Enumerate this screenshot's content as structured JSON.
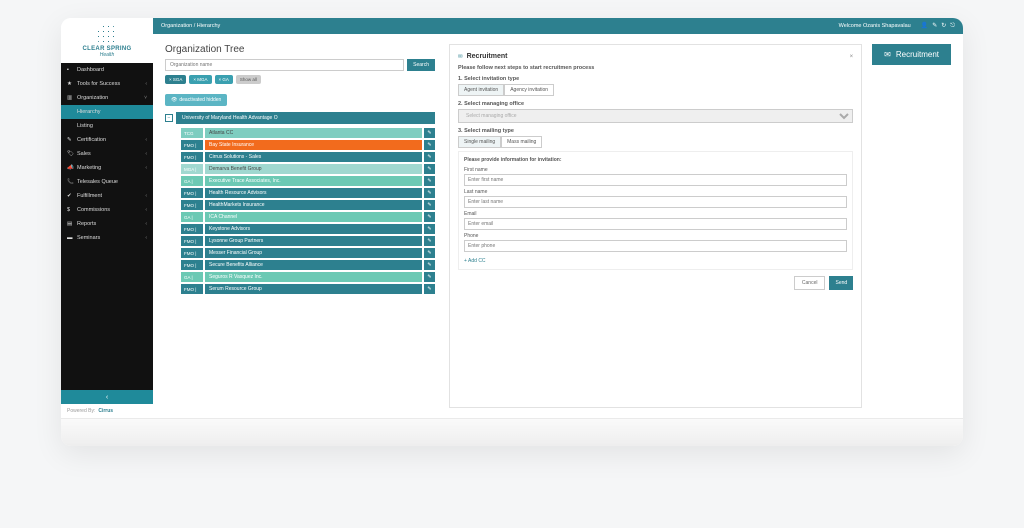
{
  "logo": {
    "line1": "CLEAR SPRING",
    "line2": "Health"
  },
  "nav": {
    "items": [
      {
        "icon": "▪",
        "label": "Dashboard",
        "chev": ""
      },
      {
        "icon": "★",
        "label": "Tools for Success",
        "chev": "‹"
      },
      {
        "icon": "▥",
        "label": "Organization",
        "chev": "˅"
      }
    ],
    "sub": [
      {
        "label": "Hierarchy",
        "active": true
      },
      {
        "label": "Listing",
        "active": false
      }
    ],
    "items2": [
      {
        "icon": "✎",
        "label": "Certification",
        "chev": "‹"
      },
      {
        "icon": "🏷",
        "label": "Sales",
        "chev": "‹"
      },
      {
        "icon": "📣",
        "label": "Marketing",
        "chev": "‹"
      },
      {
        "icon": "📞",
        "label": "Telesales Queue",
        "chev": ""
      },
      {
        "icon": "✔",
        "label": "Fulfillment",
        "chev": "‹"
      },
      {
        "icon": "$",
        "label": "Commissions",
        "chev": "‹"
      },
      {
        "icon": "▤",
        "label": "Reports",
        "chev": "‹"
      },
      {
        "icon": "▬",
        "label": "Seminars",
        "chev": "‹"
      }
    ]
  },
  "collapse_icon": "‹",
  "powered": {
    "text": "Powered By:",
    "brand": "Cirrus"
  },
  "topbar": {
    "crumb": "Organization / Hierarchy",
    "welcome": "Welcome Ozanis Shapavalau",
    "icons": [
      "👤",
      "✎",
      "↻",
      "⎋"
    ]
  },
  "tree": {
    "title": "Organization Tree",
    "search_ph": "Organization name",
    "search_btn": "Search",
    "filters": [
      {
        "label": "× SGA",
        "cls": "teal"
      },
      {
        "label": "× MGA",
        "cls": "teal2"
      },
      {
        "label": "× GA",
        "cls": "teal2"
      },
      {
        "label": "Show all",
        "cls": "grey"
      }
    ],
    "deact": "deactivated hidden",
    "root_icon": "−",
    "root": "University of Maryland Health Advantage O",
    "items": [
      {
        "tag": "TCG",
        "tagcls": "TCG",
        "name": "Atlanta CC",
        "cls": "c1"
      },
      {
        "tag": "FMO |",
        "tagcls": "FMO",
        "name": "Bay State Insurance",
        "cls": "c2"
      },
      {
        "tag": "FMO |",
        "tagcls": "FMO",
        "name": "Cirrus Solutions - Sales",
        "cls": "c3"
      },
      {
        "tag": "MGA |",
        "tagcls": "MGA",
        "name": "Demarva Benefit Group",
        "cls": "c4"
      },
      {
        "tag": "GA |",
        "tagcls": "GA",
        "name": "Executive Trace Associates, Inc.",
        "cls": "c5"
      },
      {
        "tag": "FMO |",
        "tagcls": "FMO",
        "name": "Health Resource Advisors",
        "cls": "c3"
      },
      {
        "tag": "FMO |",
        "tagcls": "FMO",
        "name": "HealthMarkets Insurance",
        "cls": "c3"
      },
      {
        "tag": "GA |",
        "tagcls": "GA",
        "name": "ICA Channel",
        "cls": "c5"
      },
      {
        "tag": "FMO |",
        "tagcls": "FMO",
        "name": "Keystone Advisors",
        "cls": "c3"
      },
      {
        "tag": "FMO |",
        "tagcls": "FMO",
        "name": "Lysonne Group Partners",
        "cls": "c3"
      },
      {
        "tag": "FMO |",
        "tagcls": "FMO",
        "name": "Messer Financial Group",
        "cls": "c3"
      },
      {
        "tag": "FMO |",
        "tagcls": "FMO",
        "name": "Secure Benefits Alliance",
        "cls": "c3"
      },
      {
        "tag": "GA |",
        "tagcls": "GA",
        "name": "Seguros R Vasquez Inc.",
        "cls": "c5"
      },
      {
        "tag": "FMO |",
        "tagcls": "FMO",
        "name": "Serum Resource Group",
        "cls": "c3"
      }
    ],
    "edit_icon": "✎"
  },
  "panel": {
    "icon": "✉",
    "title": "Recruitment",
    "close": "×",
    "intro": "Please follow next steps to start recruitmen process",
    "step1": "1. Select invitation type",
    "tab1a": "Agent invitation",
    "tab1b": "Agency invitation",
    "step2": "2. Select managing office",
    "select_ph": "Select managing office",
    "step3": "3. Select mailing type",
    "tab3a": "Single mailing",
    "tab3b": "Mass mailing",
    "note": "Please provide information for invitation:",
    "f_first": "First name",
    "f_first_ph": "Enter first name",
    "f_last": "Last name",
    "f_last_ph": "Enter last name",
    "f_email": "Email",
    "f_email_ph": "Enter email",
    "f_phone": "Phone",
    "f_phone_ph": "Enter phone",
    "addcc": "+ Add CC",
    "cancel": "Cancel",
    "send": "Send"
  },
  "bigbtn": {
    "icon": "✉",
    "label": "Recruitment"
  }
}
